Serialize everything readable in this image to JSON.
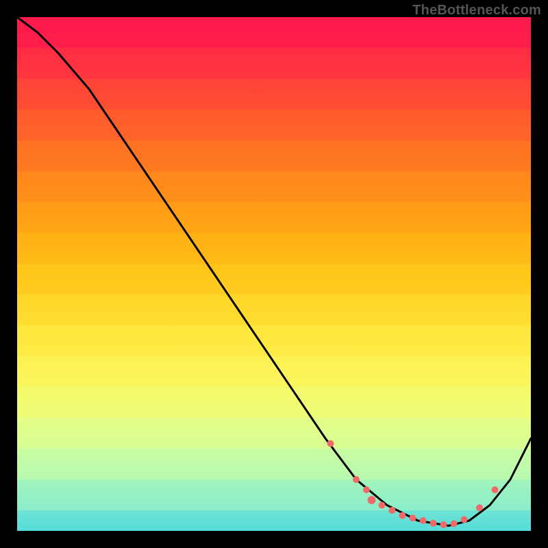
{
  "watermark": "TheBottleneck.com",
  "colors": {
    "curve": "#000000",
    "dot_fill": "#f06a6a",
    "dot_stroke": "#f06a6a"
  },
  "chart_data": {
    "type": "line",
    "title": "",
    "xlabel": "",
    "ylabel": "",
    "xlim": [
      0,
      100
    ],
    "ylim": [
      0,
      100
    ],
    "grid": false,
    "legend": false,
    "series": [
      {
        "name": "curve",
        "role": "line",
        "x": [
          0,
          4,
          8,
          14,
          60,
          66,
          72,
          78,
          84,
          88,
          92,
          96,
          100
        ],
        "y": [
          100,
          97,
          93,
          86,
          18,
          10,
          5,
          2,
          1,
          2,
          5,
          10,
          18
        ]
      },
      {
        "name": "dots",
        "role": "scatter",
        "points": [
          {
            "x": 61,
            "y": 17,
            "r": 5
          },
          {
            "x": 66,
            "y": 10,
            "r": 5
          },
          {
            "x": 68,
            "y": 8,
            "r": 5
          },
          {
            "x": 69,
            "y": 6,
            "r": 6
          },
          {
            "x": 71,
            "y": 5,
            "r": 5
          },
          {
            "x": 73,
            "y": 4,
            "r": 5
          },
          {
            "x": 75,
            "y": 3,
            "r": 5
          },
          {
            "x": 77,
            "y": 2.5,
            "r": 5
          },
          {
            "x": 79,
            "y": 2,
            "r": 5
          },
          {
            "x": 81,
            "y": 1.5,
            "r": 5
          },
          {
            "x": 83,
            "y": 1.2,
            "r": 5
          },
          {
            "x": 85,
            "y": 1.4,
            "r": 5
          },
          {
            "x": 87,
            "y": 2.2,
            "r": 5
          },
          {
            "x": 90,
            "y": 4.5,
            "r": 5
          },
          {
            "x": 93,
            "y": 8,
            "r": 5
          }
        ]
      }
    ]
  }
}
